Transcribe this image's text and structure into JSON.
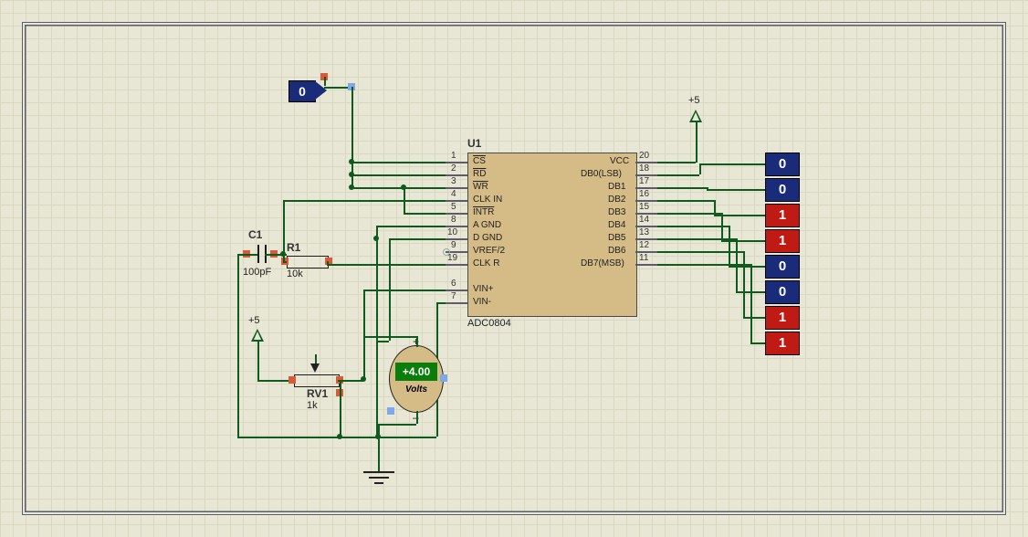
{
  "power": {
    "label_left": "+5",
    "label_right": "+5"
  },
  "logic_source": {
    "value": "0"
  },
  "components": {
    "C1": {
      "ref": "C1",
      "value": "100pF"
    },
    "R1": {
      "ref": "R1",
      "value": "10k"
    },
    "RV1": {
      "ref": "RV1",
      "value": "1k"
    },
    "U1": {
      "ref": "U1",
      "part": "ADC0804",
      "left_pins": [
        {
          "num": "1",
          "name": "CS",
          "over": true
        },
        {
          "num": "2",
          "name": "RD",
          "over": true
        },
        {
          "num": "3",
          "name": "WR",
          "over": true
        },
        {
          "num": "4",
          "name": "CLK IN"
        },
        {
          "num": "5",
          "name": "INTR",
          "over": true
        },
        {
          "num": "8",
          "name": "A GND"
        },
        {
          "num": "10",
          "name": "D GND"
        },
        {
          "num": "9",
          "name": "VREF/2"
        },
        {
          "num": "19",
          "name": "CLK R"
        }
      ],
      "left_pins2": [
        {
          "num": "6",
          "name": "VIN+"
        },
        {
          "num": "7",
          "name": "VIN-"
        }
      ],
      "right_pins": [
        {
          "num": "20",
          "name": "VCC"
        },
        {
          "num": "18",
          "name": "DB0(LSB)"
        },
        {
          "num": "17",
          "name": "DB1"
        },
        {
          "num": "16",
          "name": "DB2"
        },
        {
          "num": "15",
          "name": "DB3"
        },
        {
          "num": "14",
          "name": "DB4"
        },
        {
          "num": "13",
          "name": "DB5"
        },
        {
          "num": "12",
          "name": "DB6"
        },
        {
          "num": "11",
          "name": "DB7(MSB)"
        }
      ]
    }
  },
  "voltmeter": {
    "reading": "+4.00",
    "unit": "Volts",
    "pos": "+",
    "neg": "–"
  },
  "output_bits": [
    "0",
    "0",
    "1",
    "1",
    "0",
    "0",
    "1",
    "1"
  ]
}
